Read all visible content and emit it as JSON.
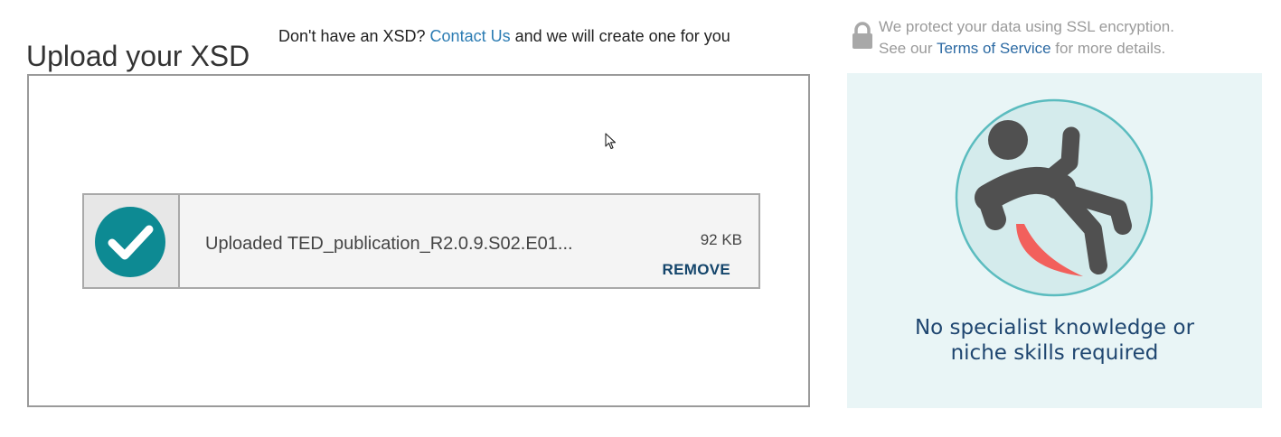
{
  "header": {
    "title": "Upload your XSD",
    "contact_prefix": "Don't have an XSD? ",
    "contact_link": "Contact Us",
    "contact_suffix": " and we will create one for you"
  },
  "security": {
    "line1": "We protect your data using SSL encryption.",
    "line2_prefix": "See our ",
    "terms_link": "Terms of Service",
    "line2_suffix": " for more details.",
    "icon": "lock-icon"
  },
  "upload": {
    "file": {
      "label": "Uploaded TED_publication_R2.0.9.S02.E01...",
      "size": "92 KB",
      "remove_label": "REMOVE",
      "status_icon": "check-circle-icon"
    }
  },
  "promo": {
    "caption_line1": "No specialist knowledge or",
    "caption_line2": "niche skills required",
    "icon": "falling-person-icon"
  },
  "colors": {
    "accent_teal": "#0d8a93",
    "link_blue": "#2c7cb3",
    "remove_navy": "#14456b",
    "promo_bg": "#e9f5f6",
    "promo_text": "#1f4670",
    "illustration_red": "#f2605c"
  }
}
